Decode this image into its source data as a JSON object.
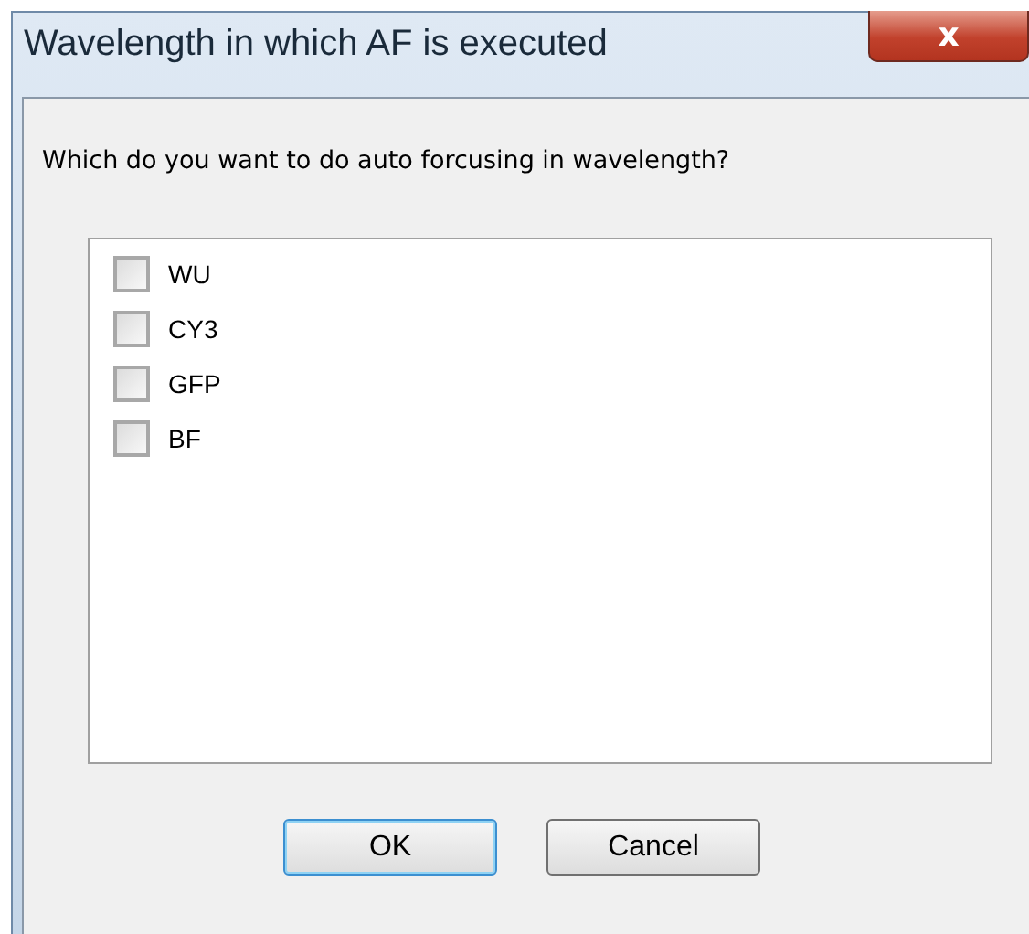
{
  "window": {
    "title": "Wavelength in which AF is executed",
    "close_label": "x"
  },
  "prompt": "Which do you want to do auto forcusing in wavelength?",
  "options": [
    {
      "label": "WU",
      "checked": false
    },
    {
      "label": "CY3",
      "checked": false
    },
    {
      "label": "GFP",
      "checked": false
    },
    {
      "label": "BF",
      "checked": false
    }
  ],
  "buttons": [
    {
      "label": "OK",
      "default": true
    },
    {
      "label": "Cancel",
      "default": false
    }
  ]
}
